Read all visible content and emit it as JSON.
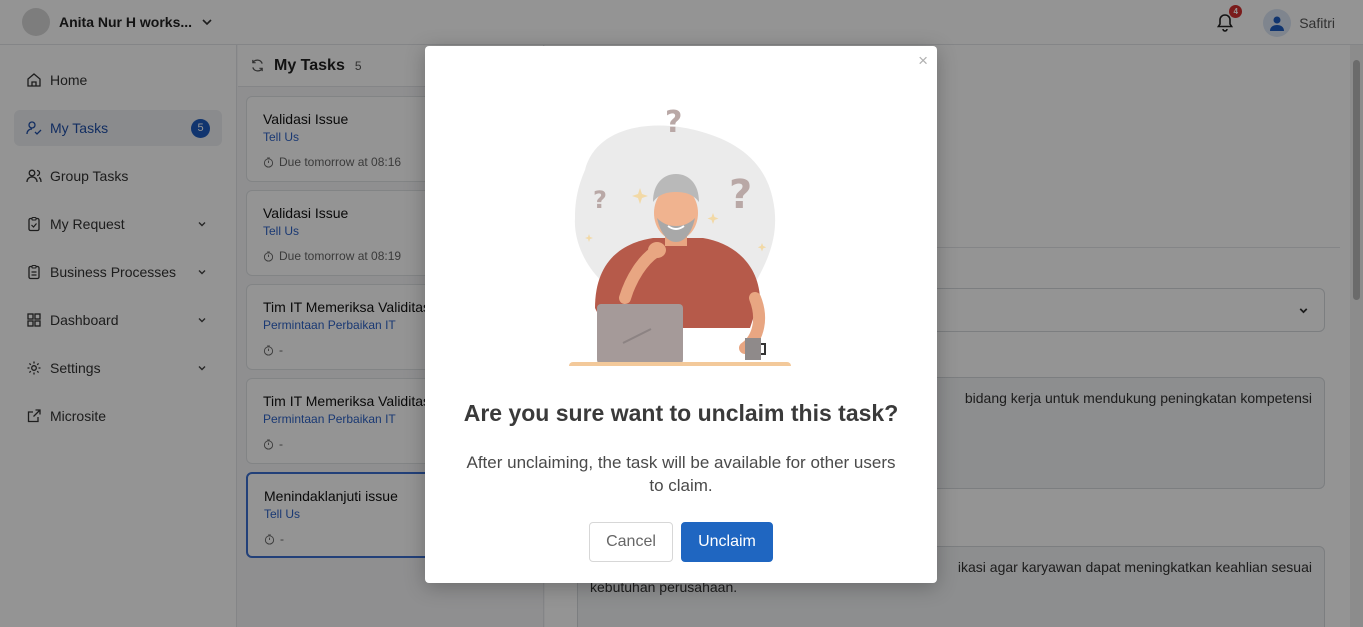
{
  "header": {
    "workspace_name": "Anita Nur H works...",
    "notification_count": "4",
    "user_name": "Safitri"
  },
  "sidebar": {
    "items": [
      {
        "label": "Home",
        "icon": "home-icon"
      },
      {
        "label": "My Tasks",
        "icon": "user-check-icon",
        "count": "5",
        "active": true
      },
      {
        "label": "Group Tasks",
        "icon": "users-icon"
      },
      {
        "label": "My Request",
        "icon": "clipboard-icon",
        "has_chevron": true
      },
      {
        "label": "Business Processes",
        "icon": "clipboard-list-icon",
        "has_chevron": true
      },
      {
        "label": "Dashboard",
        "icon": "grid-icon",
        "has_chevron": true
      },
      {
        "label": "Settings",
        "icon": "gear-icon",
        "has_chevron": true
      },
      {
        "label": "Microsite",
        "icon": "external-link-icon"
      }
    ]
  },
  "tasks": {
    "title": "My Tasks",
    "count": "5",
    "cards": [
      {
        "title": "Validasi Issue",
        "subtitle": "Tell Us",
        "due": "Due tomorrow at 08:16"
      },
      {
        "title": "Validasi Issue",
        "subtitle": "Tell Us",
        "due": "Due tomorrow at 08:19"
      },
      {
        "title": "Tim IT Memeriksa Validitas",
        "subtitle": "Permintaan Perbaikan IT",
        "due": "-"
      },
      {
        "title": "Tim IT Memeriksa Validitas",
        "subtitle": "Permintaan Perbaikan IT",
        "due": "-"
      },
      {
        "title": "Menindaklanjuti issue",
        "subtitle": "Tell Us",
        "due": "-",
        "selected": true
      }
    ]
  },
  "detail": {
    "area1_line1": "bidang kerja untuk mendukung peningkatan kompetensi",
    "area2_line1": "ikasi agar karyawan dapat meningkatkan keahlian sesuai",
    "area2_line2": "kebutuhan perusahaan."
  },
  "modal": {
    "close_label": "×",
    "title": "Are you sure want to unclaim this task?",
    "message": "After unclaiming, the task will be available for other users to claim.",
    "cancel_label": "Cancel",
    "confirm_label": "Unclaim"
  },
  "colors": {
    "primary": "#1f66c1",
    "link": "#2e63c7",
    "badge": "#d32f2f"
  }
}
